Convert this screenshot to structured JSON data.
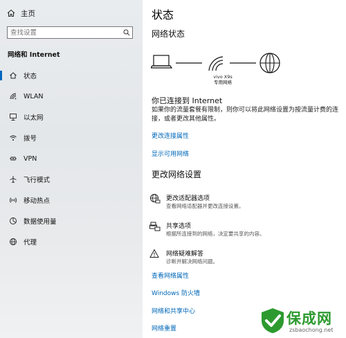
{
  "sidebar": {
    "home_label": "主页",
    "search_placeholder": "查找设置",
    "section_title": "网络和 Internet",
    "items": [
      {
        "label": "状态",
        "icon": "home-status-icon",
        "active": true
      },
      {
        "label": "WLAN",
        "icon": "wifi-icon"
      },
      {
        "label": "以太网",
        "icon": "ethernet-icon"
      },
      {
        "label": "拨号",
        "icon": "dialup-icon"
      },
      {
        "label": "VPN",
        "icon": "vpn-icon"
      },
      {
        "label": "飞行模式",
        "icon": "airplane-icon"
      },
      {
        "label": "移动热点",
        "icon": "hotspot-icon"
      },
      {
        "label": "数据使用量",
        "icon": "data-usage-icon"
      },
      {
        "label": "代理",
        "icon": "globe-icon"
      }
    ]
  },
  "main": {
    "title": "状态",
    "network_status_title": "网络状态",
    "network_name": "vivo X9s",
    "network_type": "专用网络",
    "connected_heading": "你已连接到 Internet",
    "connected_desc": "如果你的流量套餐有限制，则你可以将此网络设置为按流量计费的连接，或者更改其他属性。",
    "link_change_props": "更改连接属性",
    "link_show_networks": "显示可用网络",
    "change_settings_title": "更改网络设置",
    "options": [
      {
        "title": "更改适配器选项",
        "desc": "查看网络适配器并更改连接设置。"
      },
      {
        "title": "共享选项",
        "desc": "根据所连接到的网络，决定要共享的内容。"
      },
      {
        "title": "网络疑难解答",
        "desc": "诊断并解决网络问题。"
      }
    ],
    "bottom_links": [
      "查看网络属性",
      "Windows 防火墙",
      "网络和共享中心",
      "网络重置"
    ]
  },
  "watermark": {
    "title": "保成网",
    "url": "zsbaochong.net"
  },
  "colors": {
    "accent": "#0067c0",
    "link": "#0067b8",
    "watermark_green": "#2d9a2f"
  }
}
